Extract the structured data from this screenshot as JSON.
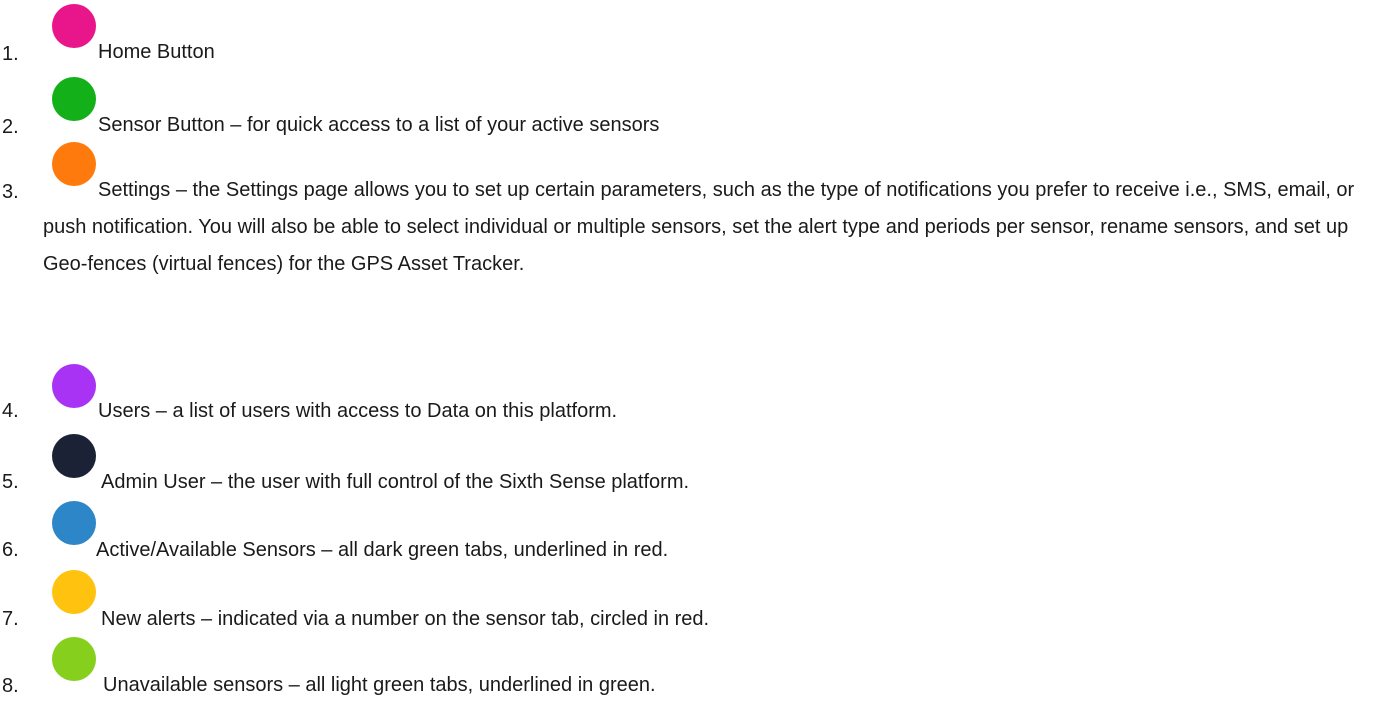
{
  "items": [
    {
      "number": "1.",
      "color": "#e8168a",
      "color_name": "magenta",
      "text": "Home Button"
    },
    {
      "number": "2.",
      "color": "#13b01a",
      "color_name": "green",
      "text": "Sensor Button – for quick access to a list of your active sensors"
    },
    {
      "number": "3.",
      "color": "#ff7a0d",
      "color_name": "orange",
      "text": "Settings – the Settings page allows you to set up certain parameters, such as the type of notifications you prefer to receive i.e., SMS, email, or push notification. You will also be able to select individual or multiple sensors, set the alert type and periods per sensor, rename sensors, and set up Geo-fences (virtual fences) for the GPS Asset Tracker."
    },
    {
      "number": "4.",
      "color": "#a833f5",
      "color_name": "purple",
      "text": "Users – a list of users with access to Data on this platform."
    },
    {
      "number": "5.",
      "color": "#1b2235",
      "color_name": "navy",
      "text": "Admin User – the user with full control of the Sixth Sense platform."
    },
    {
      "number": "6.",
      "color": "#2c86c8",
      "color_name": "blue",
      "text": "Active/Available Sensors – all dark green tabs, underlined in red."
    },
    {
      "number": "7.",
      "color": "#ffc20e",
      "color_name": "yellow",
      "text": "New alerts – indicated via a number on the sensor tab, circled in red."
    },
    {
      "number": "8.",
      "color": "#86cf1c",
      "color_name": "light-green",
      "text": "Unavailable sensors – all light green tabs, underlined in green."
    }
  ]
}
